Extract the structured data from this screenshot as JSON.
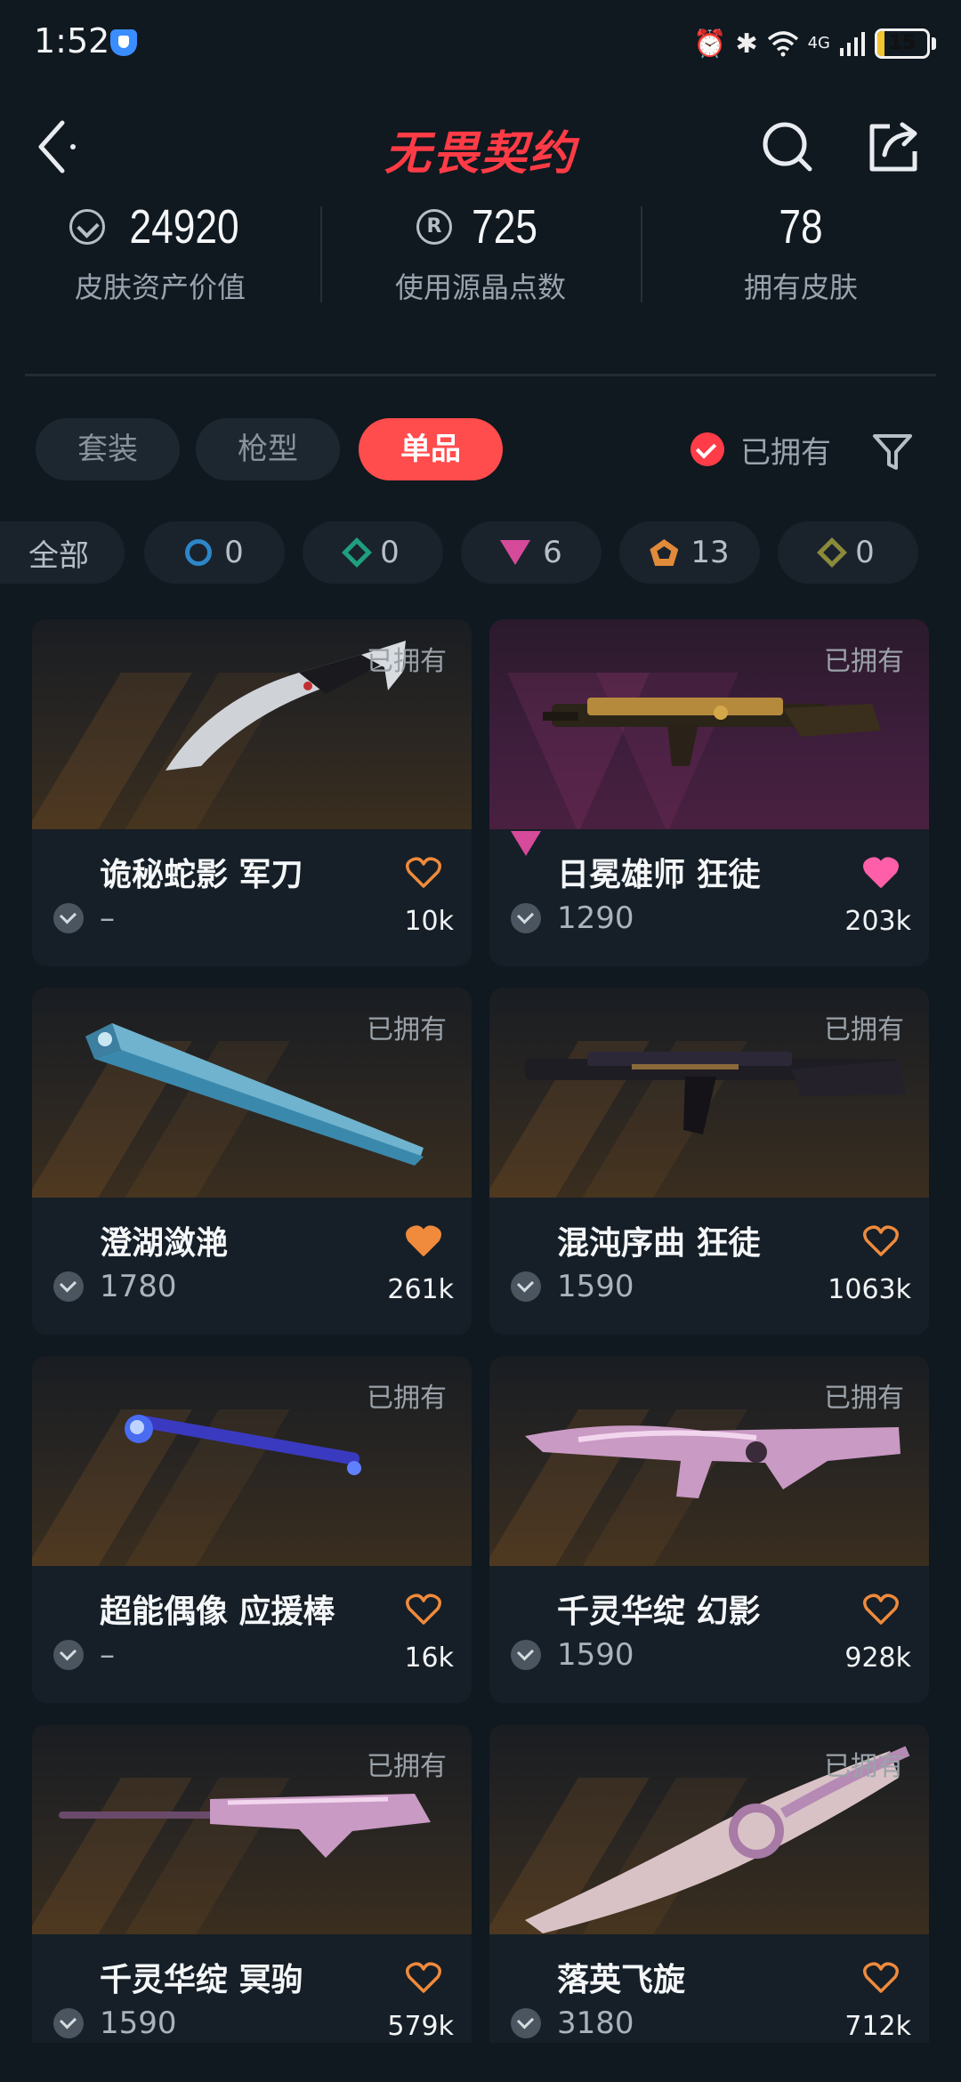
{
  "status_bar": {
    "time": "1:52",
    "network": "4G",
    "battery": "15",
    "battery_level": 0.15
  },
  "header": {
    "app_title": "无畏契约"
  },
  "stats": [
    {
      "icon": "valorant-points-icon",
      "value": "24920",
      "label": "皮肤资产价值"
    },
    {
      "icon": "radianite-points-icon",
      "value": "725",
      "label": "使用源晶点数"
    },
    {
      "icon": "",
      "value": "78",
      "label": "拥有皮肤"
    }
  ],
  "tabs": [
    {
      "label": "套装",
      "active": false
    },
    {
      "label": "枪型",
      "active": false
    },
    {
      "label": "单品",
      "active": true
    }
  ],
  "filters": {
    "owned_label": "已拥有",
    "owned_checked": true
  },
  "chips": [
    {
      "label": "全部",
      "icon": ""
    },
    {
      "label": "0",
      "icon": "select-tier-icon",
      "color": "#2d86c9"
    },
    {
      "label": "0",
      "icon": "deluxe-tier-icon",
      "color": "#1f9f7d"
    },
    {
      "label": "6",
      "icon": "premium-tier-icon",
      "color": "#d64a9a"
    },
    {
      "label": "13",
      "icon": "exclusive-tier-icon",
      "color": "#e08a3a"
    },
    {
      "label": "0",
      "icon": "ultra-tier-icon",
      "color": "#8a8a3a"
    }
  ],
  "colors": {
    "accent": "#ff4c4c",
    "background": "#101820",
    "card": "#161f27",
    "heart_liked": "#ff5fa8",
    "heart_orange": "#f08a3c"
  },
  "items": [
    {
      "name": "诡秘蛇影 军刀",
      "owned_tag": "已拥有",
      "price": "–",
      "likes": "10k",
      "rarity": "exclusive",
      "liked": false,
      "bg": "gold",
      "weapon": "knife"
    },
    {
      "name": "日冕雄师 狂徒",
      "owned_tag": "已拥有",
      "price": "1290",
      "likes": "203k",
      "rarity": "premium",
      "liked": true,
      "bg": "purple",
      "weapon": "rifle-gold"
    },
    {
      "name": "澄湖潋滟",
      "owned_tag": "已拥有",
      "price": "1780",
      "likes": "261k",
      "rarity": "exclusive",
      "liked": true,
      "bg": "gold",
      "weapon": "fan"
    },
    {
      "name": "混沌序曲 狂徒",
      "owned_tag": "已拥有",
      "price": "1590",
      "likes": "1063k",
      "rarity": "exclusive",
      "liked": false,
      "bg": "gold",
      "weapon": "rifle-dark"
    },
    {
      "name": "超能偶像 应援棒",
      "owned_tag": "已拥有",
      "price": "–",
      "likes": "16k",
      "rarity": "exclusive",
      "liked": false,
      "bg": "gold",
      "weapon": "baton"
    },
    {
      "name": "千灵华绽 幻影",
      "owned_tag": "已拥有",
      "price": "1590",
      "likes": "928k",
      "rarity": "exclusive",
      "liked": false,
      "bg": "gold",
      "weapon": "rifle-pink"
    },
    {
      "name": "千灵华绽 冥驹",
      "owned_tag": "已拥有",
      "price": "1590",
      "likes": "579k",
      "rarity": "exclusive",
      "liked": false,
      "bg": "gold",
      "weapon": "sniper-pink"
    },
    {
      "name": "落英飞旋",
      "owned_tag": "已拥有",
      "price": "3180",
      "likes": "712k",
      "rarity": "exclusive",
      "liked": false,
      "bg": "gold",
      "weapon": "knife-pink"
    }
  ]
}
